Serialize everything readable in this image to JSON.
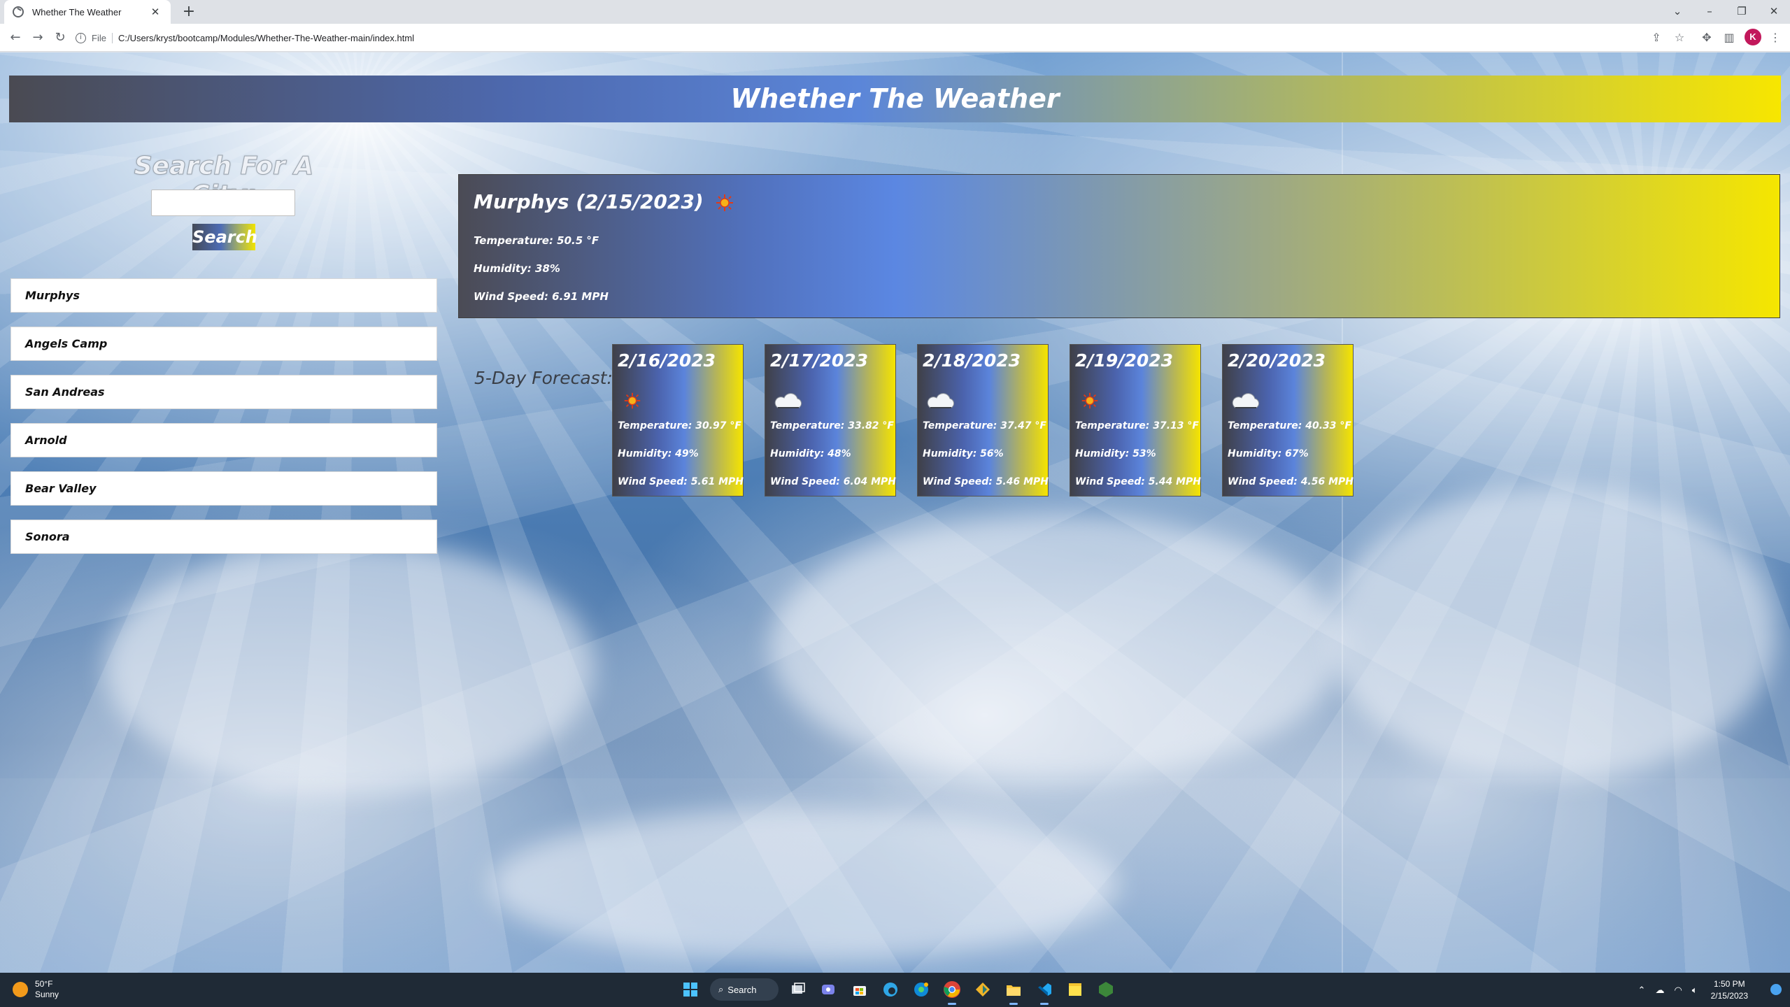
{
  "browser": {
    "tab_title": "Whether The Weather",
    "tab_close": "✕",
    "new_tab": "+",
    "file_chip": "File",
    "url": "C:/Users/kryst/bootcamp/Modules/Whether-The-Weather-main/index.html",
    "profile_initial": "K",
    "window_controls": {
      "tab_search": "⌄",
      "minimize": "–",
      "maximize": "❐",
      "close": "✕"
    }
  },
  "app": {
    "title": "Whether The Weather",
    "search": {
      "heading": "Search For A City:",
      "input_value": "",
      "button_label": "Search"
    },
    "history": [
      {
        "label": "Murphys"
      },
      {
        "label": "Angels Camp"
      },
      {
        "label": "San Andreas"
      },
      {
        "label": "Arnold"
      },
      {
        "label": "Bear Valley"
      },
      {
        "label": "Sonora"
      }
    ],
    "current": {
      "title": "Murphys (2/15/2023)",
      "icon": "sun-icon",
      "temperature": "Temperature: 50.5 °F",
      "humidity": "Humidity: 38%",
      "wind": "Wind Speed: 6.91 MPH"
    },
    "forecast_label": "5-Day Forecast:",
    "forecast": [
      {
        "date": "2/16/2023",
        "icon": "sun-icon",
        "temperature": "Temperature: 30.97 °F",
        "humidity": "Humidity: 49%",
        "wind": "Wind Speed: 5.61 MPH"
      },
      {
        "date": "2/17/2023",
        "icon": "cloud-icon",
        "temperature": "Temperature: 33.82 °F",
        "humidity": "Humidity: 48%",
        "wind": "Wind Speed: 6.04 MPH"
      },
      {
        "date": "2/18/2023",
        "icon": "cloud-icon",
        "temperature": "Temperature: 37.47 °F",
        "humidity": "Humidity: 56%",
        "wind": "Wind Speed: 5.46 MPH"
      },
      {
        "date": "2/19/2023",
        "icon": "sun-icon",
        "temperature": "Temperature: 37.13 °F",
        "humidity": "Humidity: 53%",
        "wind": "Wind Speed: 5.44 MPH"
      },
      {
        "date": "2/20/2023",
        "icon": "cloud-icon",
        "temperature": "Temperature: 40.33 °F",
        "humidity": "Humidity: 67%",
        "wind": "Wind Speed: 4.56 MPH"
      }
    ],
    "colors": {
      "header_start": "#4a4a52",
      "header_mid": "#5b86d9",
      "header_end": "#f7e600"
    }
  },
  "taskbar": {
    "weather_temp": "50°F",
    "weather_desc": "Sunny",
    "search_label": "Search",
    "time": "1:50 PM",
    "date": "2/15/2023"
  }
}
